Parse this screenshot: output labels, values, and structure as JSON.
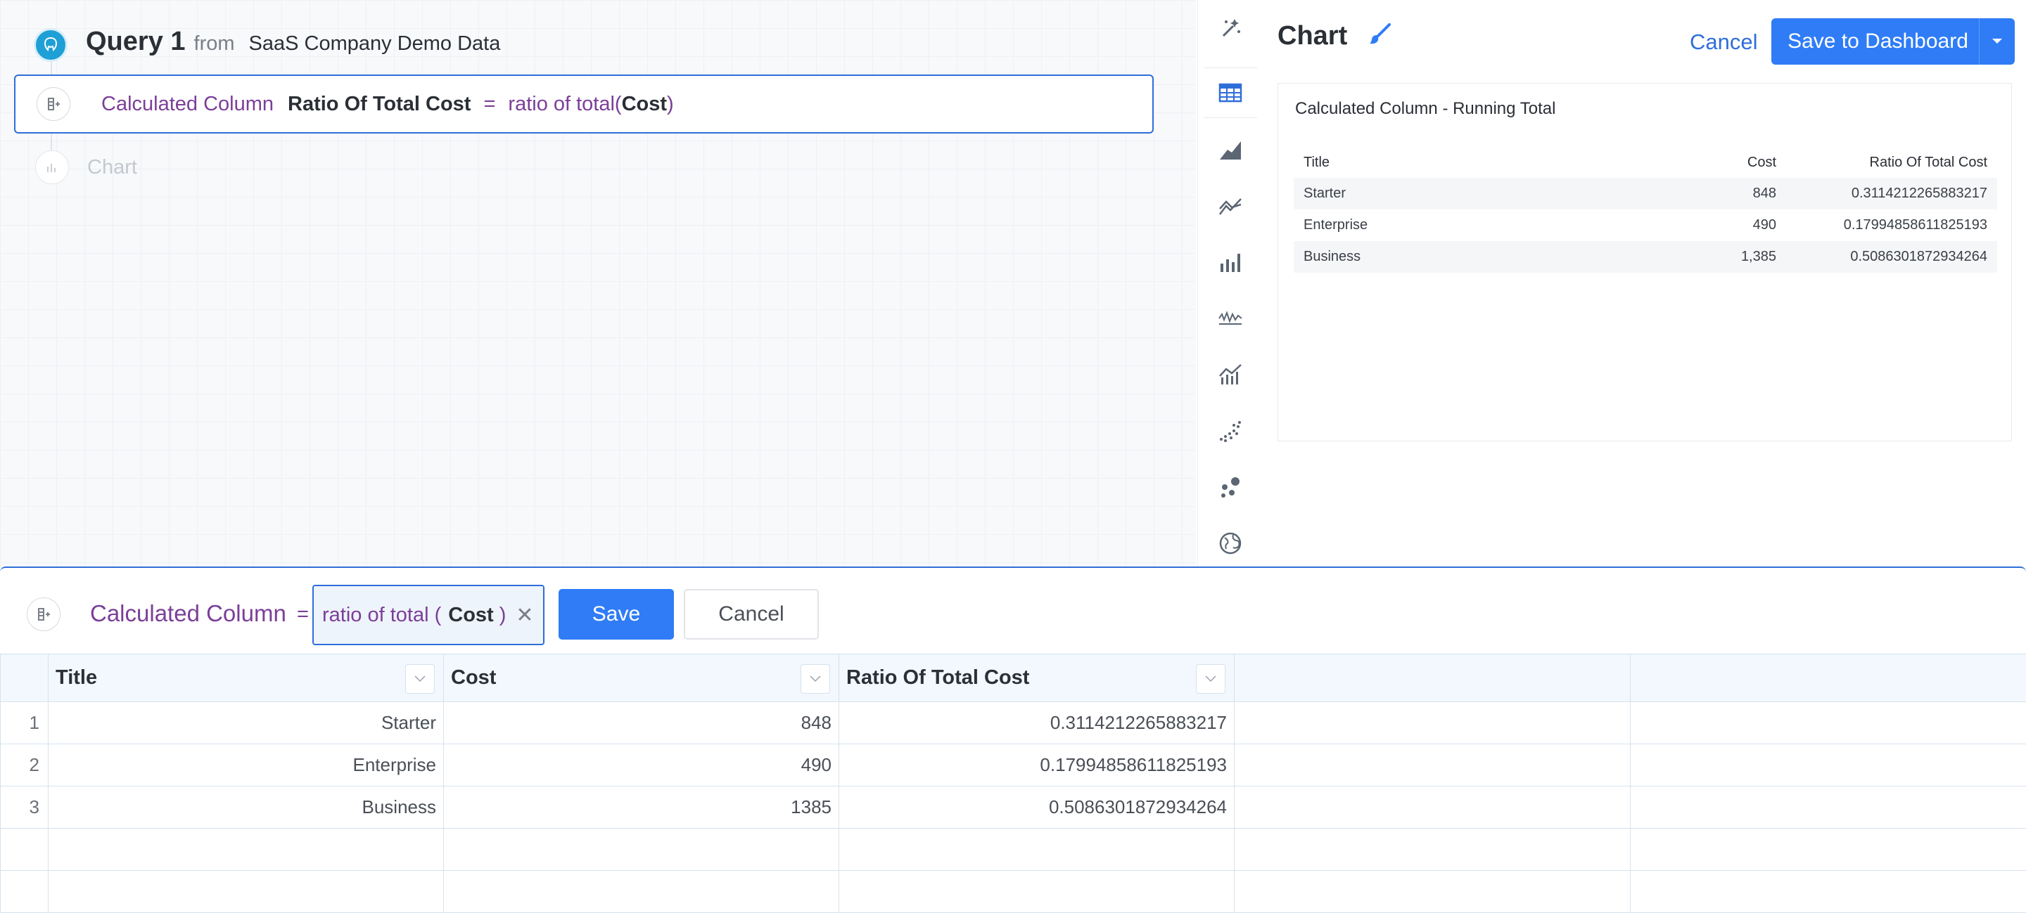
{
  "query": {
    "name": "Query 1",
    "from_word": "from",
    "source": "SaaS Company Demo Data"
  },
  "steps": [
    {
      "kind": "Calculated Column",
      "column": "Ratio Of Total Cost",
      "equals": "=",
      "func": "ratio of total(",
      "arg": "Cost",
      "close": ")"
    },
    {
      "kind": "Chart"
    }
  ],
  "chart_types": [
    "magic-wand-icon",
    "table-icon",
    "area-chart-icon",
    "line-chart-icon",
    "bar-chart-icon",
    "sparkline-icon",
    "combo-chart-icon",
    "scatter-icon",
    "bubble-icon",
    "globe-icon"
  ],
  "chart_panel": {
    "title": "Chart",
    "cancel_label": "Cancel",
    "save_label": "Save to Dashboard",
    "accent": "#2f7cf6"
  },
  "preview": {
    "title": "Calculated Column - Running Total",
    "headers": [
      "Title",
      "Cost",
      "Ratio Of Total Cost"
    ],
    "rows": [
      [
        "Starter",
        "848",
        "0.3114212265883217"
      ],
      [
        "Enterprise",
        "490",
        "0.17994858611825193"
      ],
      [
        "Business",
        "1,385",
        "0.5086301872934264"
      ]
    ]
  },
  "editor": {
    "label": "Calculated Column",
    "equals": "=",
    "formula_func": "ratio of total (",
    "formula_arg": "Cost",
    "formula_close": ")",
    "save_label": "Save",
    "cancel_label": "Cancel"
  },
  "grid": {
    "headers": [
      "Title",
      "Cost",
      "Ratio Of Total Cost",
      "",
      ""
    ],
    "rows": [
      {
        "n": "1",
        "cells": [
          "Starter",
          "848",
          "0.3114212265883217",
          "",
          ""
        ]
      },
      {
        "n": "2",
        "cells": [
          "Enterprise",
          "490",
          "0.17994858611825193",
          "",
          ""
        ]
      },
      {
        "n": "3",
        "cells": [
          "Business",
          "1385",
          "0.5086301872934264",
          "",
          ""
        ]
      },
      {
        "n": "",
        "cells": [
          "",
          "",
          "",
          "",
          ""
        ]
      },
      {
        "n": "",
        "cells": [
          "",
          "",
          "",
          "",
          ""
        ]
      }
    ]
  }
}
